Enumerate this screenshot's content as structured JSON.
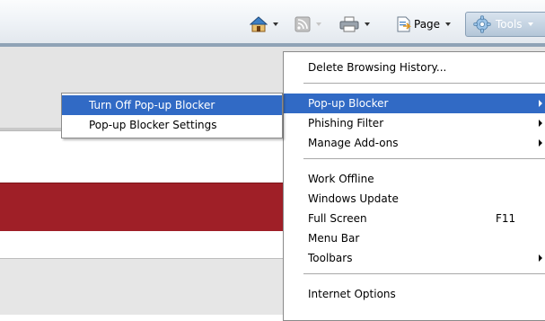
{
  "toolbar": {
    "home": {
      "icon": "home-icon"
    },
    "feeds": {
      "icon": "rss-feeds-icon"
    },
    "print": {
      "icon": "printer-icon"
    },
    "page": {
      "label": "Page",
      "icon": "page-icon"
    },
    "tools": {
      "label": "Tools",
      "icon": "gear-icon"
    }
  },
  "tools_menu": {
    "items": [
      {
        "label": "Delete Browsing History..."
      },
      {
        "label": "Pop-up Blocker"
      },
      {
        "label": "Phishing Filter"
      },
      {
        "label": "Manage Add-ons"
      },
      {
        "label": "Work Offline"
      },
      {
        "label": "Windows Update"
      },
      {
        "label": "Full Screen",
        "shortcut": "F11"
      },
      {
        "label": "Menu Bar"
      },
      {
        "label": "Toolbars"
      },
      {
        "label": "Internet Options"
      }
    ]
  },
  "popup_submenu": {
    "items": [
      {
        "label": "Turn Off Pop-up Blocker"
      },
      {
        "label": "Pop-up Blocker Settings"
      }
    ]
  },
  "colors": {
    "highlight": "#316ac5",
    "banner_red": "#9f1f27"
  }
}
